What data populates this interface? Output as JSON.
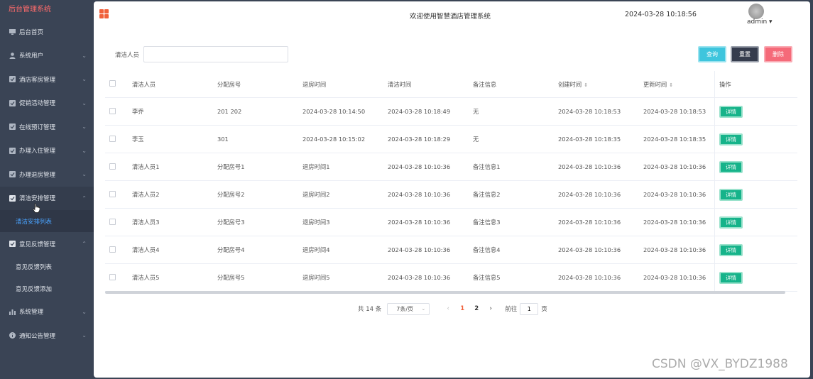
{
  "sidebar": {
    "brand": "后台管理系统",
    "items": [
      {
        "label": "后台首页",
        "icon": "monitor-icon",
        "chevron": ""
      },
      {
        "label": "系统用户",
        "icon": "user-icon",
        "chevron": "⌄"
      },
      {
        "label": "酒店客房管理",
        "icon": "check-square-icon",
        "chevron": "⌄"
      },
      {
        "label": "促销活动管理",
        "icon": "check-square-icon",
        "chevron": "⌄"
      },
      {
        "label": "在线预订管理",
        "icon": "check-square-icon",
        "chevron": "⌄"
      },
      {
        "label": "办理入住管理",
        "icon": "check-square-icon",
        "chevron": "⌄"
      },
      {
        "label": "办理退房管理",
        "icon": "check-square-icon",
        "chevron": "⌄"
      },
      {
        "label": "清洁安排管理",
        "icon": "check-square-icon",
        "chevron": "⌃"
      },
      {
        "label": "意见反馈管理",
        "icon": "check-square-icon",
        "chevron": "⌃"
      },
      {
        "label": "系统管理",
        "icon": "bar-chart-icon",
        "chevron": "⌄"
      },
      {
        "label": "通知公告管理",
        "icon": "info-circle-icon",
        "chevron": "⌄"
      }
    ],
    "sub_cleaning": [
      "清洁安排列表"
    ],
    "sub_feedback": [
      "意见反馈列表",
      "意见反馈添加"
    ]
  },
  "header": {
    "welcome": "欢迎使用智慧酒店管理系统",
    "datetime": "2024-03-28 10:18:56",
    "user": "admin ▾"
  },
  "search": {
    "label": "清洁人员",
    "value": "",
    "query_label": "查询",
    "reset_label": "重置",
    "delete_label": "删除"
  },
  "table": {
    "headers": {
      "name": "清洁人员",
      "room": "分配房号",
      "checkout": "退房时间",
      "clean": "清洁时间",
      "note": "备注信息",
      "create": "创建时间",
      "update": "更新时间",
      "op": "操作"
    },
    "sort_glyph": "⇕",
    "detail_label": "详情",
    "rows": [
      {
        "name": "李乔",
        "room": "201 202",
        "checkout": "2024-03-28 10:14:50",
        "clean": "2024-03-28 10:18:49",
        "note": "无",
        "create": "2024-03-28 10:18:53",
        "update": "2024-03-28 10:18:53"
      },
      {
        "name": "李玉",
        "room": "301",
        "checkout": "2024-03-28 10:15:02",
        "clean": "2024-03-28 10:18:29",
        "note": "无",
        "create": "2024-03-28 10:18:35",
        "update": "2024-03-28 10:18:35"
      },
      {
        "name": "清洁人员1",
        "room": "分配房号1",
        "checkout": "退房时间1",
        "clean": "2024-03-28 10:10:36",
        "note": "备注信息1",
        "create": "2024-03-28 10:10:36",
        "update": "2024-03-28 10:10:36"
      },
      {
        "name": "清洁人员2",
        "room": "分配房号2",
        "checkout": "退房时间2",
        "clean": "2024-03-28 10:10:36",
        "note": "备注信息2",
        "create": "2024-03-28 10:10:36",
        "update": "2024-03-28 10:10:36"
      },
      {
        "name": "清洁人员3",
        "room": "分配房号3",
        "checkout": "退房时间3",
        "clean": "2024-03-28 10:10:36",
        "note": "备注信息3",
        "create": "2024-03-28 10:10:36",
        "update": "2024-03-28 10:10:36"
      },
      {
        "name": "清洁人员4",
        "room": "分配房号4",
        "checkout": "退房时间4",
        "clean": "2024-03-28 10:10:36",
        "note": "备注信息4",
        "create": "2024-03-28 10:10:36",
        "update": "2024-03-28 10:10:36"
      },
      {
        "name": "清洁人员5",
        "room": "分配房号5",
        "checkout": "退房时间5",
        "clean": "2024-03-28 10:10:36",
        "note": "备注信息5",
        "create": "2024-03-28 10:10:36",
        "update": "2024-03-28 10:10:36"
      }
    ]
  },
  "pagination": {
    "total": "共 14 条",
    "page_size": "7条/页",
    "prev": "‹",
    "next": "›",
    "pages": [
      "1",
      "2"
    ],
    "current": "1",
    "goto_label": "前往",
    "goto_value": "1",
    "page_unit": "页"
  },
  "watermark": "CSDN @VX_BYDZ1988",
  "colors": {
    "sidebar_bg": "#3a4455",
    "accent": "#f0603a",
    "active_link": "#4aa3ff",
    "query_btn": "#3ec5dd",
    "reset_btn": "#353c4d",
    "delete_btn": "#f56a79",
    "detail_btn": "#16b38a"
  }
}
